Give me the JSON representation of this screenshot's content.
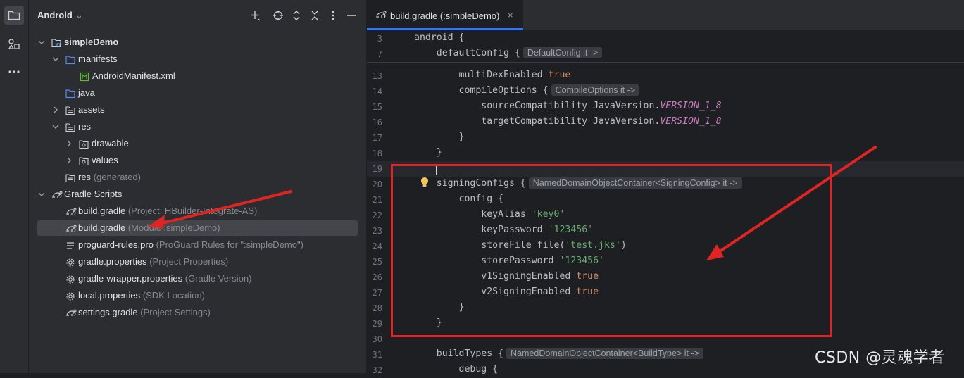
{
  "project": {
    "view_label": "Android",
    "tree": [
      {
        "label": "simpleDemo",
        "hint": "",
        "bold": true,
        "icon": "module-folder-icon",
        "expanded": true
      },
      {
        "label": "manifests",
        "hint": "",
        "icon": "folder-icon",
        "expanded": true
      },
      {
        "label": "AndroidManifest.xml",
        "hint": "",
        "icon": "manifest-file-icon"
      },
      {
        "label": "java",
        "hint": "",
        "icon": "folder-icon"
      },
      {
        "label": "assets",
        "hint": "",
        "icon": "resource-folder-icon",
        "expanded": false
      },
      {
        "label": "res",
        "hint": "",
        "icon": "resource-folder-icon",
        "expanded": true
      },
      {
        "label": "drawable",
        "hint": "",
        "icon": "package-folder-icon",
        "expanded": false
      },
      {
        "label": "values",
        "hint": "",
        "icon": "package-folder-icon",
        "expanded": false
      },
      {
        "label": "res",
        "hint": "(generated)",
        "icon": "resource-folder-icon"
      },
      {
        "label": "Gradle Scripts",
        "hint": "",
        "icon": "gradle-icon",
        "expanded": true
      },
      {
        "label": "build.gradle",
        "hint": "(Project: HBuilder-Integrate-AS)",
        "icon": "gradle-icon"
      },
      {
        "label": "build.gradle",
        "hint": "(Module :simpleDemo)",
        "icon": "gradle-icon",
        "selected": true
      },
      {
        "label": "proguard-rules.pro",
        "hint": "(ProGuard Rules for \":simpleDemo\")",
        "icon": "text-file-icon"
      },
      {
        "label": "gradle.properties",
        "hint": "(Project Properties)",
        "icon": "settings-gear-icon"
      },
      {
        "label": "gradle-wrapper.properties",
        "hint": "(Gradle Version)",
        "icon": "settings-gear-icon"
      },
      {
        "label": "local.properties",
        "hint": "(SDK Location)",
        "icon": "settings-gear-icon"
      },
      {
        "label": "settings.gradle",
        "hint": "(Project Settings)",
        "icon": "gradle-icon"
      }
    ]
  },
  "editor": {
    "tab_label": "build.gradle (:simpleDemo)",
    "tab_close": "×",
    "sticky": [
      {
        "n": "3",
        "code": "android {"
      },
      {
        "n": "7",
        "code": "    defaultConfig {",
        "inlay": "DefaultConfig it ->"
      }
    ],
    "lines": [
      {
        "n": "13",
        "parts": [
          [
            "",
            "        multiDexEnabled "
          ],
          [
            "kw",
            "true"
          ]
        ]
      },
      {
        "n": "14",
        "parts": [
          [
            "",
            "        compileOptions {"
          ]
        ],
        "inlay": "CompileOptions it ->"
      },
      {
        "n": "15",
        "parts": [
          [
            "",
            "            sourceCompatibility JavaVersion."
          ],
          [
            "con",
            "VERSION_1_8"
          ]
        ]
      },
      {
        "n": "16",
        "parts": [
          [
            "",
            "            targetCompatibility JavaVersion."
          ],
          [
            "con",
            "VERSION_1_8"
          ]
        ]
      },
      {
        "n": "17",
        "parts": [
          [
            "",
            "        }"
          ]
        ]
      },
      {
        "n": "18",
        "parts": [
          [
            "",
            "    }"
          ]
        ]
      },
      {
        "n": "19",
        "parts": [
          [
            "",
            ""
          ]
        ],
        "current": true
      },
      {
        "n": "20",
        "parts": [
          [
            "",
            "    signingConfigs {"
          ]
        ],
        "inlay": "NamedDomainObjectContainer<SigningConfig> it ->"
      },
      {
        "n": "21",
        "parts": [
          [
            "",
            "        config {"
          ]
        ]
      },
      {
        "n": "22",
        "parts": [
          [
            "",
            "            keyAlias "
          ],
          [
            "str",
            "'key0'"
          ]
        ]
      },
      {
        "n": "23",
        "parts": [
          [
            "",
            "            keyPassword "
          ],
          [
            "str",
            "'123456'"
          ]
        ]
      },
      {
        "n": "24",
        "parts": [
          [
            "",
            "            storeFile file("
          ],
          [
            "str",
            "'test.jks'"
          ],
          [
            "",
            ")"
          ]
        ]
      },
      {
        "n": "25",
        "parts": [
          [
            "",
            "            storePassword "
          ],
          [
            "str",
            "'123456'"
          ]
        ]
      },
      {
        "n": "26",
        "parts": [
          [
            "",
            "            v1SigningEnabled "
          ],
          [
            "kw",
            "true"
          ]
        ]
      },
      {
        "n": "27",
        "parts": [
          [
            "",
            "            v2SigningEnabled "
          ],
          [
            "kw",
            "true"
          ]
        ]
      },
      {
        "n": "28",
        "parts": [
          [
            "",
            "        }"
          ]
        ]
      },
      {
        "n": "29",
        "parts": [
          [
            "",
            "    }"
          ]
        ]
      },
      {
        "n": "30",
        "parts": [
          [
            "",
            ""
          ]
        ]
      },
      {
        "n": "31",
        "parts": [
          [
            "",
            "    buildTypes {"
          ]
        ],
        "inlay": "NamedDomainObjectContainer<BuildType> it ->"
      },
      {
        "n": "32",
        "parts": [
          [
            "",
            "        debug {"
          ]
        ]
      }
    ]
  },
  "watermark": "CSDN @灵魂学者",
  "colors": {
    "accent": "#3574f0",
    "annotation": "#e02424",
    "keyword": "#cf8e6d",
    "string": "#6aab73",
    "constant": "#c77dbb"
  }
}
